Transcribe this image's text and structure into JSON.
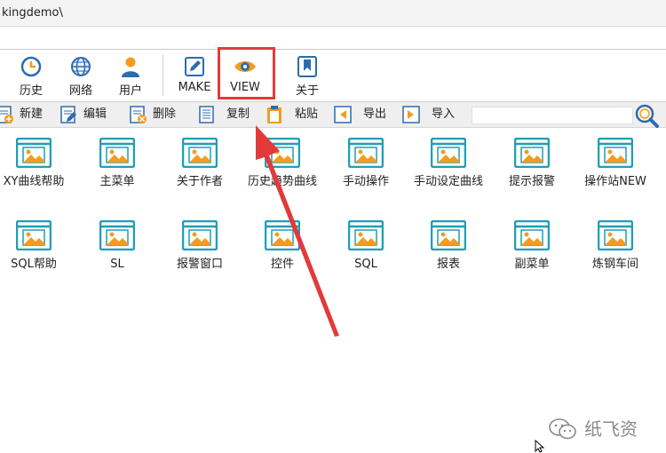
{
  "path": "kingdemo\\",
  "ribbon": {
    "items": [
      {
        "label": "历史",
        "icon": "clock-icon"
      },
      {
        "label": "网络",
        "icon": "globe-icon"
      },
      {
        "label": "用户",
        "icon": "user-icon"
      },
      {
        "label": "MAKE",
        "icon": "edit-icon"
      },
      {
        "label": "VIEW",
        "icon": "eye-icon"
      },
      {
        "label": "关于",
        "icon": "bookmark-icon"
      }
    ]
  },
  "toolbar": {
    "new": "新建",
    "edit": "编辑",
    "delete": "删除",
    "copy": "复制",
    "paste": "粘贴",
    "export": "导出",
    "import": "导入",
    "search_value": ""
  },
  "screens": [
    "XY曲线帮助",
    "主菜单",
    "关于作者",
    "历史趋势曲线",
    "手动操作",
    "手动设定曲线",
    "提示报警",
    "操作站NEW",
    "SQL帮助",
    "SL",
    "报警窗口",
    "控件",
    "SQL",
    "报表",
    "副菜单",
    "炼钢车间"
  ],
  "watermark": "纸飞资",
  "colors": {
    "accent_red": "#e23a3a",
    "image_icon_teal": "#1e9fb5",
    "image_icon_orange": "#f39c1e",
    "icon_blue": "#2b6cb0"
  }
}
